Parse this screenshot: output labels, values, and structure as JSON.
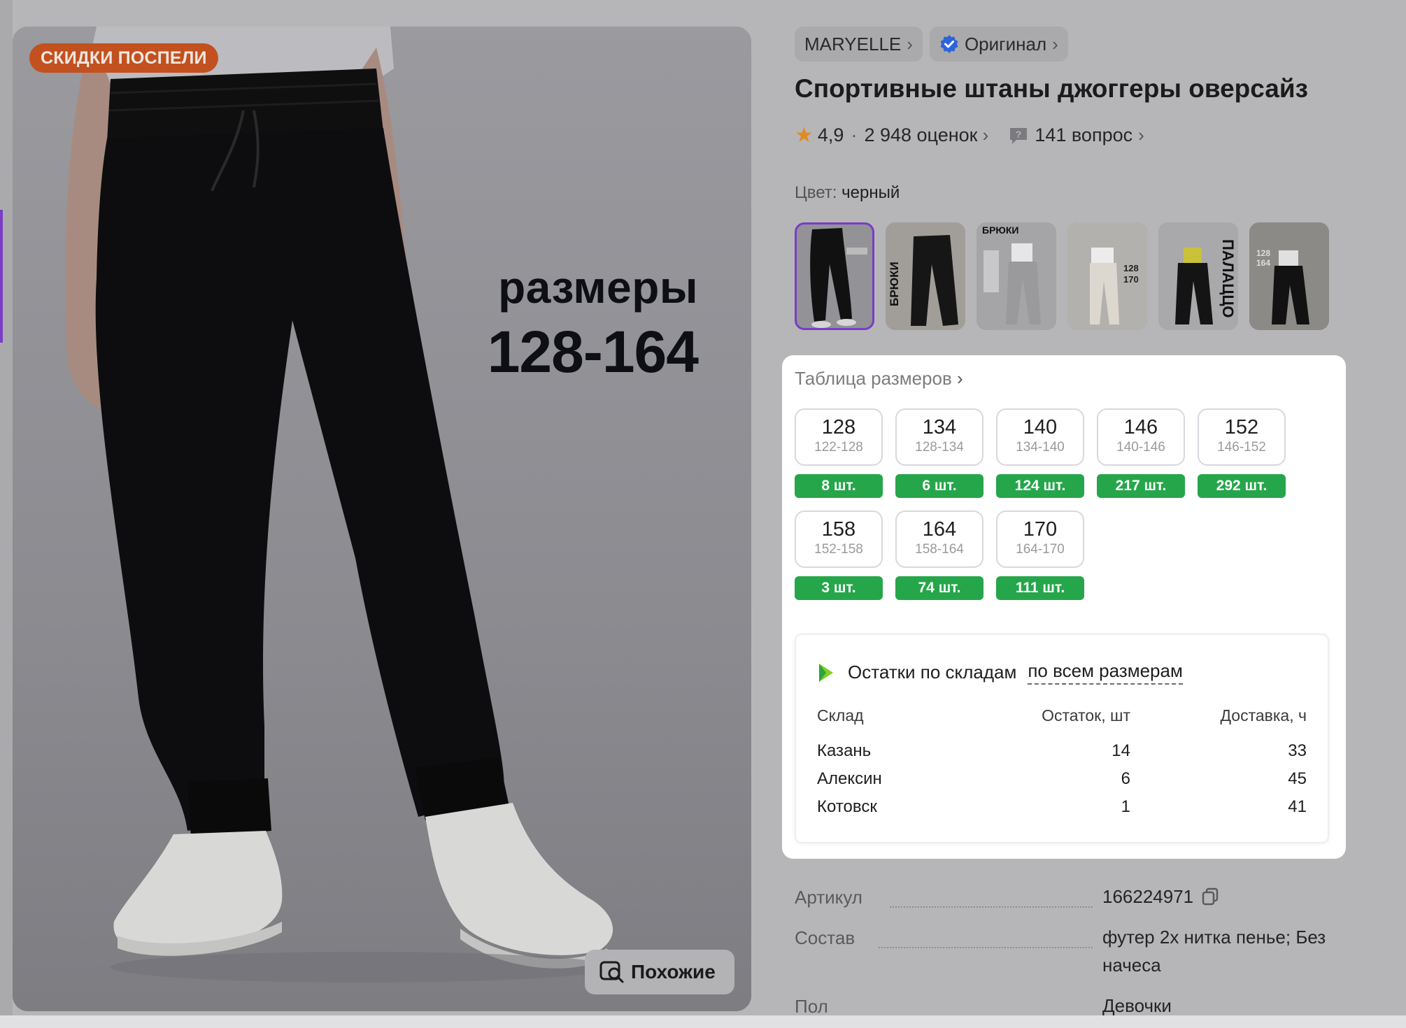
{
  "photo": {
    "promo_badge": "СКИДКИ ПОСПЕЛИ",
    "caption_word": "размеры",
    "caption_range": "128-164",
    "similar_label": "Похожие",
    "similar_icon": "search-similar-icon"
  },
  "brand": {
    "name": "MARYELLE",
    "original_label": "Оригинал"
  },
  "product": {
    "title": "Спортивные штаны джоггеры оверсайз",
    "rating": "4,9",
    "reviews": "2 948 оценок",
    "questions": "141 вопрос",
    "color_key": "Цвет:",
    "color_value": "черный"
  },
  "thumbnails": [
    {
      "label": "размеры 128-164",
      "selected": true
    },
    {
      "label": "БРЮКИ",
      "selected": false
    },
    {
      "label": "БРЮКИ",
      "selected": false
    },
    {
      "label": "128 170",
      "selected": false
    },
    {
      "label": "ПАЛАЦЦО",
      "selected": false
    },
    {
      "label": "128 164",
      "selected": false
    }
  ],
  "sizes": {
    "table_link": "Таблица размеров",
    "items": [
      {
        "size": "128",
        "range": "122-128",
        "stock": "8 шт."
      },
      {
        "size": "134",
        "range": "128-134",
        "stock": "6 шт."
      },
      {
        "size": "140",
        "range": "134-140",
        "stock": "124 шт."
      },
      {
        "size": "146",
        "range": "140-146",
        "stock": "217 шт."
      },
      {
        "size": "152",
        "range": "146-152",
        "stock": "292 шт."
      },
      {
        "size": "158",
        "range": "152-158",
        "stock": "3 шт."
      },
      {
        "size": "164",
        "range": "158-164",
        "stock": "74 шт."
      },
      {
        "size": "170",
        "range": "164-170",
        "stock": "111 шт."
      }
    ]
  },
  "warehouses": {
    "title": "Остатки по складам",
    "filter": "по всем размерам",
    "columns": [
      "Склад",
      "Остаток, шт",
      "Доставка, ч"
    ],
    "rows": [
      [
        "Казань",
        "14",
        "33"
      ],
      [
        "Алексин",
        "6",
        "45"
      ],
      [
        "Котовск",
        "1",
        "41"
      ]
    ]
  },
  "specs": {
    "article_key": "Артикул",
    "article_value": "166224971",
    "composition_key": "Состав",
    "composition_value": "футер 2х нитка пенье; Без начеса",
    "gender_key": "Пол",
    "gender_value": "Девочки"
  },
  "colors": {
    "accent_purple": "#7a3ec4",
    "stock_green": "#26a64a",
    "promo_orange": "#c2511f",
    "star": "#e08b22"
  }
}
